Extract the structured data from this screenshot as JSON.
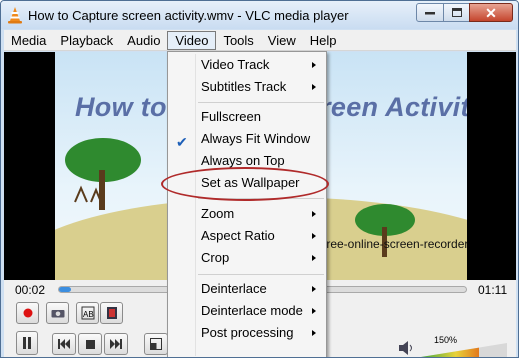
{
  "window": {
    "title": "How to Capture screen activity.wmv - VLC media player"
  },
  "menubar": {
    "items": [
      "Media",
      "Playback",
      "Audio",
      "Video",
      "Tools",
      "View",
      "Help"
    ],
    "active": "Video"
  },
  "video_menu": {
    "items": [
      {
        "label": "Video Track",
        "submenu": true
      },
      {
        "label": "Subtitles Track",
        "submenu": true
      },
      {
        "label": "Fullscreen",
        "submenu": false
      },
      {
        "label": "Always Fit Window",
        "submenu": false,
        "checked": true
      },
      {
        "label": "Always on Top",
        "submenu": false
      },
      {
        "label": "Set as Wallpaper",
        "submenu": false,
        "highlighted_annotation": true
      },
      {
        "label": "Zoom",
        "submenu": true
      },
      {
        "label": "Aspect Ratio",
        "submenu": true
      },
      {
        "label": "Crop",
        "submenu": true
      },
      {
        "label": "Deinterlace",
        "submenu": true
      },
      {
        "label": "Deinterlace mode",
        "submenu": true
      },
      {
        "label": "Post processing",
        "submenu": true
      }
    ]
  },
  "video_frame": {
    "slide_title": "How to Capture Screen Activity?",
    "slide_url": "free-online-screen-recorder"
  },
  "playback": {
    "time_elapsed": "00:02",
    "time_total": "01:11",
    "progress_fraction": 0.03
  },
  "volume": {
    "level_label": "150%"
  },
  "colors": {
    "titlebar": "#c9dcf1",
    "seek_fill": "#3b8ee0",
    "annotation": "#b02a2a",
    "check": "#1d5fb8"
  }
}
